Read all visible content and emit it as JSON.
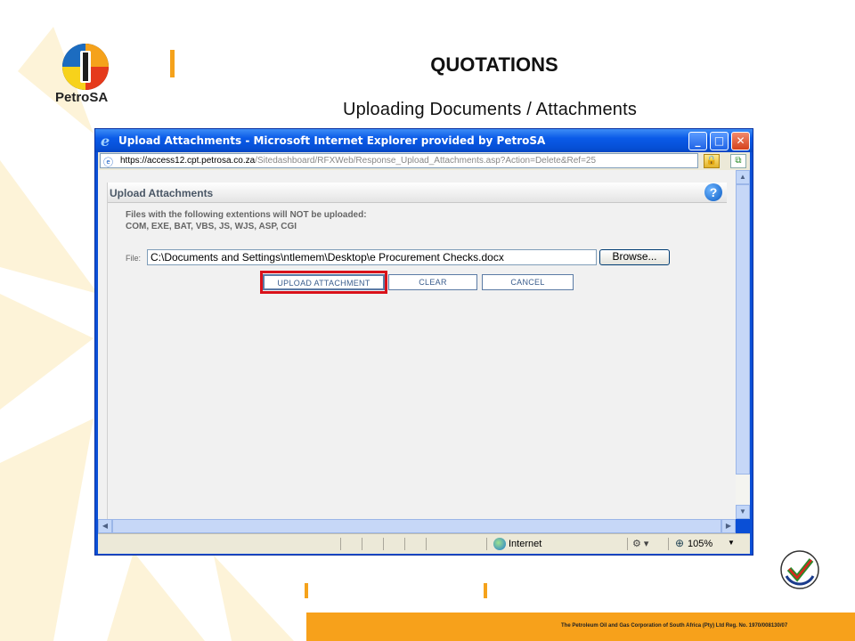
{
  "slide": {
    "logo_text": "PetroSA",
    "title": "QUOTATIONS",
    "subtitle": "Uploading Documents / Attachments",
    "footer_text": "The Petroleum Oil and Gas Corporation of South Africa (Pty) Ltd  Reg. No. 1970/008130/07"
  },
  "window": {
    "title": "Upload Attachments - Microsoft Internet Explorer provided by PetroSA",
    "min_label": "_",
    "max_label": "□",
    "close_label": "✕",
    "address_prefix": "https://access12.cpt.",
    "address_host": "petrosa.co.za",
    "address_path": "/Sitedashboard/RFXWeb/Response_Upload_Attachments.asp?Action=Delete&Ref=25"
  },
  "panel": {
    "title": "Upload Attachments",
    "help_label": "?",
    "info_line1": "Files with the following extentions will NOT be uploaded:",
    "info_line2": "COM, EXE, BAT, VBS, JS, WJS, ASP, CGI",
    "file_label": "File:",
    "file_value": "C:\\Documents and Settings\\ntlemem\\Desktop\\e Procurement Checks.docx",
    "browse_label": "Browse...",
    "upload_label": "UPLOAD ATTACHMENT",
    "clear_label": "CLEAR",
    "cancel_label": "CANCEL"
  },
  "statusbar": {
    "zone_label": "Internet",
    "zoom_label": "105%"
  },
  "colors": {
    "accent_orange": "#f7a11b",
    "highlight_red": "#d9121a",
    "xp_blue": "#0a5ae8"
  },
  "icons": [
    "ie-e-icon",
    "lock-icon",
    "compat-icon",
    "help-icon",
    "globe-zone-icon",
    "zoom-icon"
  ]
}
